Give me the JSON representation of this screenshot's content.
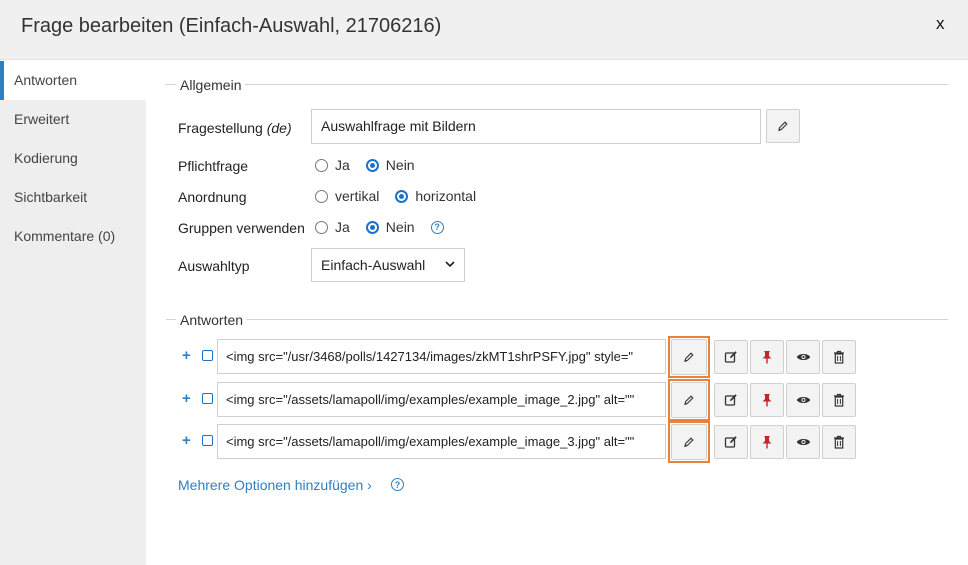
{
  "dialog": {
    "title": "Frage bearbeiten (Einfach-Auswahl, 21706216)",
    "close_label": "x"
  },
  "sidebar": {
    "items": [
      {
        "label": "Antworten",
        "active": true
      },
      {
        "label": "Erweitert"
      },
      {
        "label": "Kodierung"
      },
      {
        "label": "Sichtbarkeit"
      },
      {
        "label": "Kommentare (0)"
      }
    ]
  },
  "general": {
    "legend": "Allgemein",
    "question_label": "Fragestellung",
    "question_lang": "(de)",
    "question_value": "Auswahlfrage mit Bildern",
    "required": {
      "label": "Pflichtfrage",
      "options": [
        "Ja",
        "Nein"
      ],
      "selected": "Nein"
    },
    "layout": {
      "label": "Anordnung",
      "options": [
        "vertikal",
        "horizontal"
      ],
      "selected": "horizontal"
    },
    "groups": {
      "label": "Gruppen verwenden",
      "options": [
        "Ja",
        "Nein"
      ],
      "selected": "Nein"
    },
    "select_type": {
      "label": "Auswahltyp",
      "value": "Einfach-Auswahl"
    }
  },
  "answers": {
    "legend": "Antworten",
    "rows": [
      {
        "value": "<img src=\"/usr/3468/polls/1427134/images/zkMT1shrPSFY.jpg\" style=\""
      },
      {
        "value": "<img src=\"/assets/lamapoll/img/examples/example_image_2.jpg\" alt=\"\""
      },
      {
        "value": "<img src=\"/assets/lamapoll/img/examples/example_image_3.jpg\" alt=\"\""
      }
    ],
    "plus_label": "+",
    "more_options_label": "Mehrere Optionen hinzufügen ›"
  },
  "icons": {
    "edit": "pencil-icon",
    "edit_rich": "edit-box-icon",
    "pin": "pin-icon",
    "view": "eye-icon",
    "delete": "trash-icon",
    "help": "help-icon"
  },
  "colors": {
    "accent": "#2f7fc1",
    "highlight": "#e8823a",
    "pin": "#c0262b"
  }
}
